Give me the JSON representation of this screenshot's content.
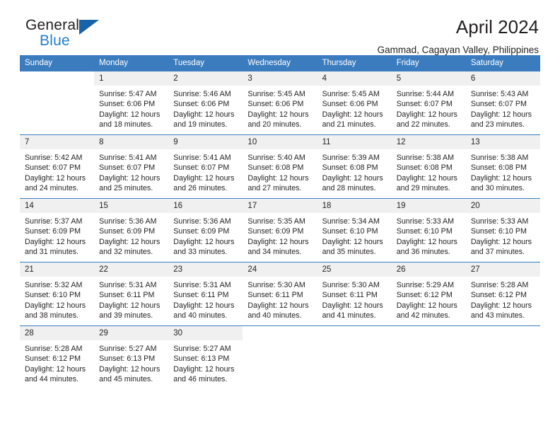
{
  "logo": {
    "word_top": "General",
    "word_bottom": "Blue",
    "triangle_icon": "triangle-icon",
    "accent_color": "#1f7fd0",
    "triangle_color": "#1763a8"
  },
  "header": {
    "title": "April 2024",
    "subtitle": "Gammad, Cagayan Valley, Philippines"
  },
  "theme": {
    "header_band": "#3b7cbf",
    "daynum_band": "#f0f0f0",
    "text": "#231f20"
  },
  "calendar": {
    "weekday_headers": [
      "Sunday",
      "Monday",
      "Tuesday",
      "Wednesday",
      "Thursday",
      "Friday",
      "Saturday"
    ],
    "weeks": [
      [
        {
          "day": "",
          "empty": true,
          "sunrise": "",
          "sunset": "",
          "daylight_line1": "",
          "daylight_line2": ""
        },
        {
          "day": "1",
          "sunrise": "Sunrise: 5:47 AM",
          "sunset": "Sunset: 6:06 PM",
          "daylight_line1": "Daylight: 12 hours",
          "daylight_line2": "and 18 minutes."
        },
        {
          "day": "2",
          "sunrise": "Sunrise: 5:46 AM",
          "sunset": "Sunset: 6:06 PM",
          "daylight_line1": "Daylight: 12 hours",
          "daylight_line2": "and 19 minutes."
        },
        {
          "day": "3",
          "sunrise": "Sunrise: 5:45 AM",
          "sunset": "Sunset: 6:06 PM",
          "daylight_line1": "Daylight: 12 hours",
          "daylight_line2": "and 20 minutes."
        },
        {
          "day": "4",
          "sunrise": "Sunrise: 5:45 AM",
          "sunset": "Sunset: 6:06 PM",
          "daylight_line1": "Daylight: 12 hours",
          "daylight_line2": "and 21 minutes."
        },
        {
          "day": "5",
          "sunrise": "Sunrise: 5:44 AM",
          "sunset": "Sunset: 6:07 PM",
          "daylight_line1": "Daylight: 12 hours",
          "daylight_line2": "and 22 minutes."
        },
        {
          "day": "6",
          "sunrise": "Sunrise: 5:43 AM",
          "sunset": "Sunset: 6:07 PM",
          "daylight_line1": "Daylight: 12 hours",
          "daylight_line2": "and 23 minutes."
        }
      ],
      [
        {
          "day": "7",
          "sunrise": "Sunrise: 5:42 AM",
          "sunset": "Sunset: 6:07 PM",
          "daylight_line1": "Daylight: 12 hours",
          "daylight_line2": "and 24 minutes."
        },
        {
          "day": "8",
          "sunrise": "Sunrise: 5:41 AM",
          "sunset": "Sunset: 6:07 PM",
          "daylight_line1": "Daylight: 12 hours",
          "daylight_line2": "and 25 minutes."
        },
        {
          "day": "9",
          "sunrise": "Sunrise: 5:41 AM",
          "sunset": "Sunset: 6:07 PM",
          "daylight_line1": "Daylight: 12 hours",
          "daylight_line2": "and 26 minutes."
        },
        {
          "day": "10",
          "sunrise": "Sunrise: 5:40 AM",
          "sunset": "Sunset: 6:08 PM",
          "daylight_line1": "Daylight: 12 hours",
          "daylight_line2": "and 27 minutes."
        },
        {
          "day": "11",
          "sunrise": "Sunrise: 5:39 AM",
          "sunset": "Sunset: 6:08 PM",
          "daylight_line1": "Daylight: 12 hours",
          "daylight_line2": "and 28 minutes."
        },
        {
          "day": "12",
          "sunrise": "Sunrise: 5:38 AM",
          "sunset": "Sunset: 6:08 PM",
          "daylight_line1": "Daylight: 12 hours",
          "daylight_line2": "and 29 minutes."
        },
        {
          "day": "13",
          "sunrise": "Sunrise: 5:38 AM",
          "sunset": "Sunset: 6:08 PM",
          "daylight_line1": "Daylight: 12 hours",
          "daylight_line2": "and 30 minutes."
        }
      ],
      [
        {
          "day": "14",
          "sunrise": "Sunrise: 5:37 AM",
          "sunset": "Sunset: 6:09 PM",
          "daylight_line1": "Daylight: 12 hours",
          "daylight_line2": "and 31 minutes."
        },
        {
          "day": "15",
          "sunrise": "Sunrise: 5:36 AM",
          "sunset": "Sunset: 6:09 PM",
          "daylight_line1": "Daylight: 12 hours",
          "daylight_line2": "and 32 minutes."
        },
        {
          "day": "16",
          "sunrise": "Sunrise: 5:36 AM",
          "sunset": "Sunset: 6:09 PM",
          "daylight_line1": "Daylight: 12 hours",
          "daylight_line2": "and 33 minutes."
        },
        {
          "day": "17",
          "sunrise": "Sunrise: 5:35 AM",
          "sunset": "Sunset: 6:09 PM",
          "daylight_line1": "Daylight: 12 hours",
          "daylight_line2": "and 34 minutes."
        },
        {
          "day": "18",
          "sunrise": "Sunrise: 5:34 AM",
          "sunset": "Sunset: 6:10 PM",
          "daylight_line1": "Daylight: 12 hours",
          "daylight_line2": "and 35 minutes."
        },
        {
          "day": "19",
          "sunrise": "Sunrise: 5:33 AM",
          "sunset": "Sunset: 6:10 PM",
          "daylight_line1": "Daylight: 12 hours",
          "daylight_line2": "and 36 minutes."
        },
        {
          "day": "20",
          "sunrise": "Sunrise: 5:33 AM",
          "sunset": "Sunset: 6:10 PM",
          "daylight_line1": "Daylight: 12 hours",
          "daylight_line2": "and 37 minutes."
        }
      ],
      [
        {
          "day": "21",
          "sunrise": "Sunrise: 5:32 AM",
          "sunset": "Sunset: 6:10 PM",
          "daylight_line1": "Daylight: 12 hours",
          "daylight_line2": "and 38 minutes."
        },
        {
          "day": "22",
          "sunrise": "Sunrise: 5:31 AM",
          "sunset": "Sunset: 6:11 PM",
          "daylight_line1": "Daylight: 12 hours",
          "daylight_line2": "and 39 minutes."
        },
        {
          "day": "23",
          "sunrise": "Sunrise: 5:31 AM",
          "sunset": "Sunset: 6:11 PM",
          "daylight_line1": "Daylight: 12 hours",
          "daylight_line2": "and 40 minutes."
        },
        {
          "day": "24",
          "sunrise": "Sunrise: 5:30 AM",
          "sunset": "Sunset: 6:11 PM",
          "daylight_line1": "Daylight: 12 hours",
          "daylight_line2": "and 40 minutes."
        },
        {
          "day": "25",
          "sunrise": "Sunrise: 5:30 AM",
          "sunset": "Sunset: 6:11 PM",
          "daylight_line1": "Daylight: 12 hours",
          "daylight_line2": "and 41 minutes."
        },
        {
          "day": "26",
          "sunrise": "Sunrise: 5:29 AM",
          "sunset": "Sunset: 6:12 PM",
          "daylight_line1": "Daylight: 12 hours",
          "daylight_line2": "and 42 minutes."
        },
        {
          "day": "27",
          "sunrise": "Sunrise: 5:28 AM",
          "sunset": "Sunset: 6:12 PM",
          "daylight_line1": "Daylight: 12 hours",
          "daylight_line2": "and 43 minutes."
        }
      ],
      [
        {
          "day": "28",
          "sunrise": "Sunrise: 5:28 AM",
          "sunset": "Sunset: 6:12 PM",
          "daylight_line1": "Daylight: 12 hours",
          "daylight_line2": "and 44 minutes."
        },
        {
          "day": "29",
          "sunrise": "Sunrise: 5:27 AM",
          "sunset": "Sunset: 6:13 PM",
          "daylight_line1": "Daylight: 12 hours",
          "daylight_line2": "and 45 minutes."
        },
        {
          "day": "30",
          "sunrise": "Sunrise: 5:27 AM",
          "sunset": "Sunset: 6:13 PM",
          "daylight_line1": "Daylight: 12 hours",
          "daylight_line2": "and 46 minutes."
        },
        {
          "day": "",
          "empty": true,
          "sunrise": "",
          "sunset": "",
          "daylight_line1": "",
          "daylight_line2": ""
        },
        {
          "day": "",
          "empty": true,
          "sunrise": "",
          "sunset": "",
          "daylight_line1": "",
          "daylight_line2": ""
        },
        {
          "day": "",
          "empty": true,
          "sunrise": "",
          "sunset": "",
          "daylight_line1": "",
          "daylight_line2": ""
        },
        {
          "day": "",
          "empty": true,
          "sunrise": "",
          "sunset": "",
          "daylight_line1": "",
          "daylight_line2": ""
        }
      ]
    ]
  }
}
